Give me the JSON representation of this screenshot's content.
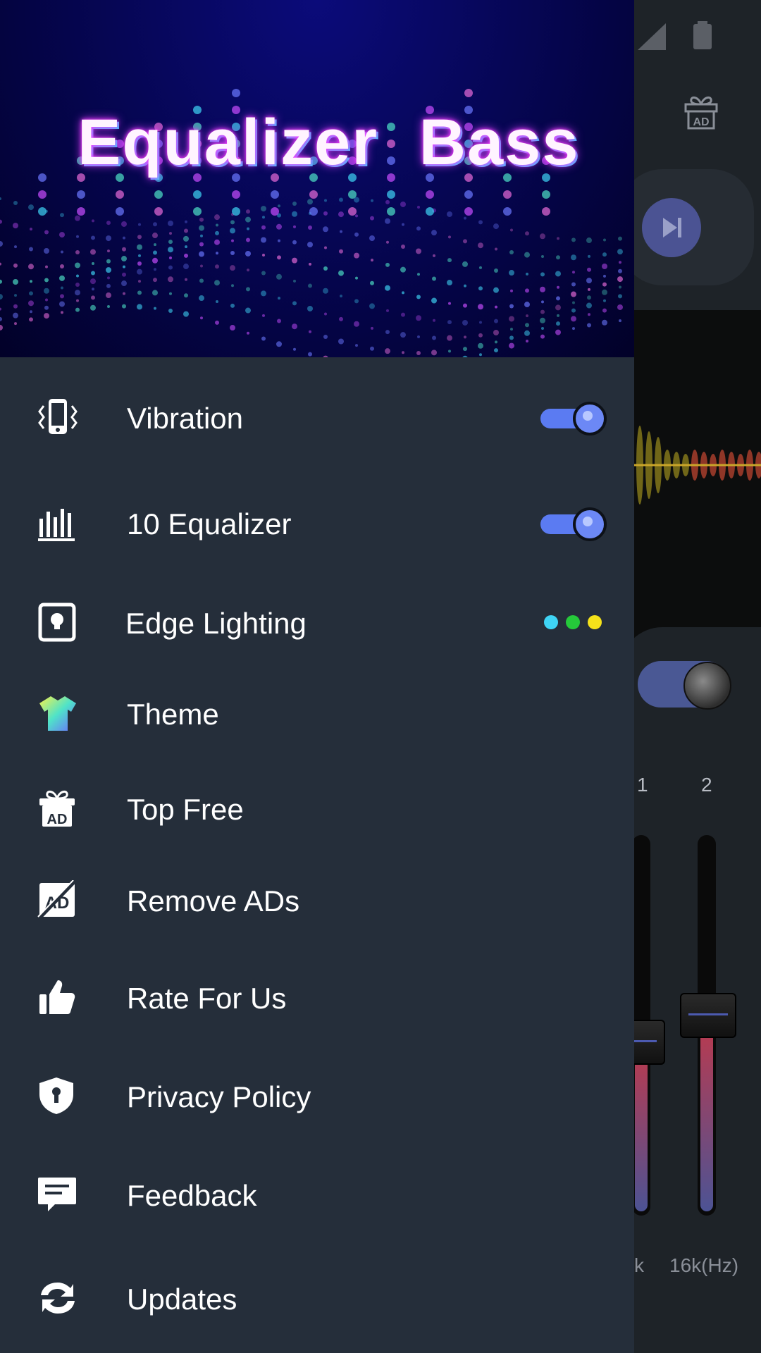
{
  "banner": {
    "title": "Equalizer  Bass"
  },
  "menu": {
    "items": [
      {
        "id": "vibration",
        "label": "Vibration",
        "icon": "vibration-icon",
        "control": "switch",
        "on": true
      },
      {
        "id": "equalizer10",
        "label": "10 Equalizer",
        "icon": "equalizer-bars-icon",
        "control": "switch",
        "on": true
      },
      {
        "id": "edge_lighting",
        "label": "Edge Lighting",
        "icon": "edge-lighting-icon",
        "control": "dots"
      },
      {
        "id": "theme",
        "label": "Theme",
        "icon": "tshirt-icon"
      },
      {
        "id": "top_free",
        "label": "Top Free",
        "icon": "gift-ad-icon"
      },
      {
        "id": "remove_ads",
        "label": "Remove ADs",
        "icon": "no-ad-icon"
      },
      {
        "id": "rate",
        "label": "Rate For Us",
        "icon": "thumbs-up-icon"
      },
      {
        "id": "privacy",
        "label": "Privacy Policy",
        "icon": "shield-lock-icon"
      },
      {
        "id": "feedback",
        "label": "Feedback",
        "icon": "chat-icon"
      },
      {
        "id": "updates",
        "label": "Updates",
        "icon": "refresh-icon"
      }
    ],
    "edge_colors": [
      "#3fd4f5",
      "#25c93a",
      "#f5e21a"
    ]
  },
  "background_app": {
    "band_numbers": [
      "1",
      "2"
    ],
    "hz_labels": [
      "k",
      "16k(Hz)"
    ],
    "slider_levels_pct": [
      46,
      53
    ],
    "bass_switch_on": true
  },
  "colors": {
    "drawer": "#252e3a",
    "accent": "#5b7bf2",
    "banner": "#05054d"
  }
}
